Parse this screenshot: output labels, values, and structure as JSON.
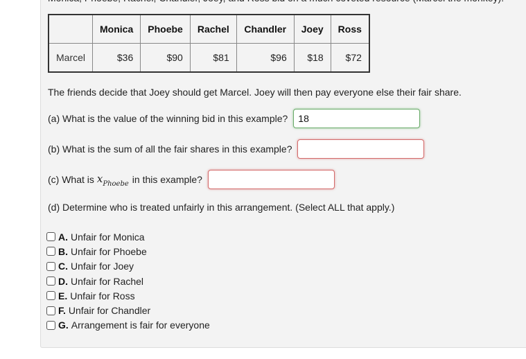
{
  "intro_clipped": "Monica, Phoebe, Rachel, Chandler, Joey, and Ross bid on a much coveted resource (Marcel the monkey).",
  "table": {
    "corner": "",
    "headers": [
      "Monica",
      "Phoebe",
      "Rachel",
      "Chandler",
      "Joey",
      "Ross"
    ],
    "rows": [
      {
        "item": "Marcel",
        "bids": [
          "$36",
          "$90",
          "$81",
          "$96",
          "$18",
          "$72"
        ]
      }
    ]
  },
  "statement": "The friends decide that Joey should get Marcel. Joey will then pay everyone else their fair share.",
  "questions": {
    "a": {
      "label": "(a) What is the value of the winning bid in this example?",
      "value": "18",
      "status": "correct"
    },
    "b": {
      "label": "(b) What is the sum of all the fair shares in this example?",
      "value": "",
      "status": "incorrect"
    },
    "c": {
      "label_prefix": "(c) What is",
      "math_var": "x",
      "math_sub": "Phoebe",
      "label_suffix": "in this example?",
      "value": "",
      "status": "incorrect"
    },
    "d": {
      "label": "(d) Determine who is treated unfairly in this arrangement. (Select ALL that apply.)"
    }
  },
  "choices": [
    {
      "letter": "A.",
      "text": "Unfair for Monica",
      "checked": false
    },
    {
      "letter": "B.",
      "text": "Unfair for Phoebe",
      "checked": false
    },
    {
      "letter": "C.",
      "text": "Unfair for Joey",
      "checked": false
    },
    {
      "letter": "D.",
      "text": "Unfair for Rachel",
      "checked": false
    },
    {
      "letter": "E.",
      "text": "Unfair for Ross",
      "checked": false
    },
    {
      "letter": "F.",
      "text": "Unfair for Chandler",
      "checked": false
    },
    {
      "letter": "G.",
      "text": "Arrangement is fair for everyone",
      "checked": false
    }
  ],
  "colors": {
    "panel_bg": "#f3f3f3",
    "correct_border": "#6aab6a",
    "incorrect_border": "#d36b6b"
  }
}
